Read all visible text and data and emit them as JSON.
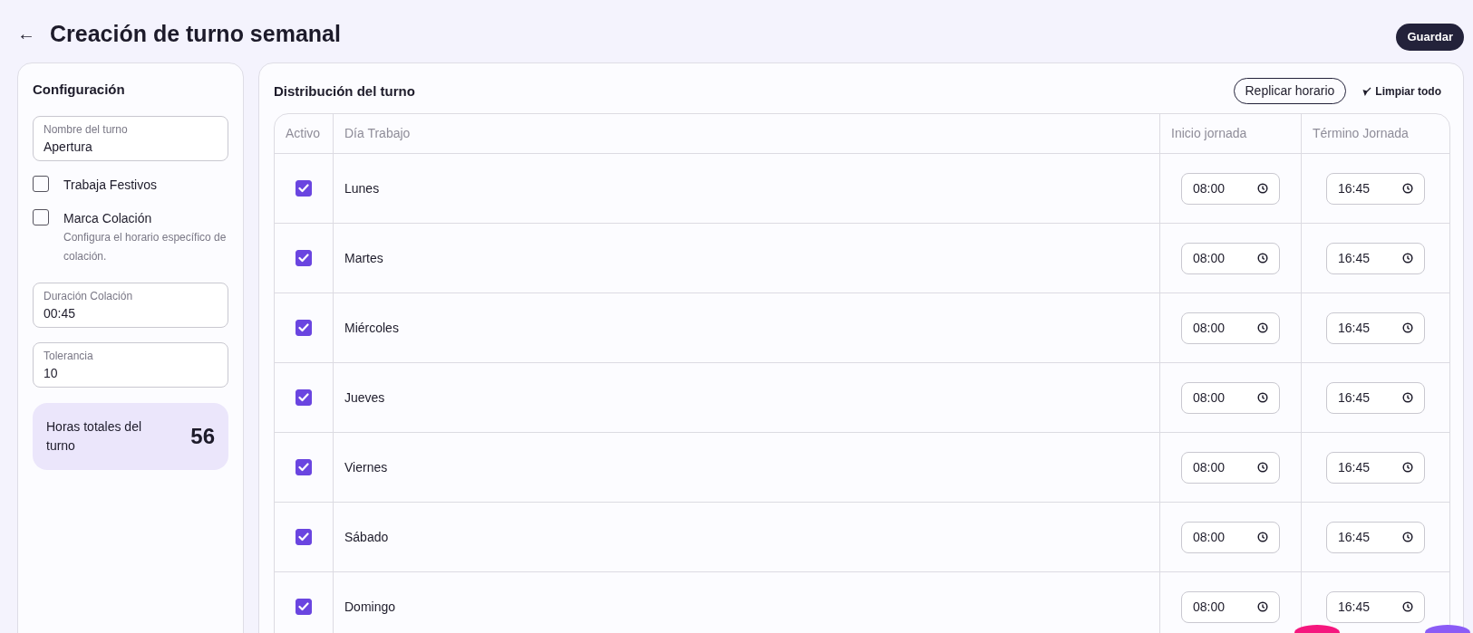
{
  "header": {
    "back_icon": "←",
    "title": "Creación de turno semanal",
    "save_button": "Guardar"
  },
  "config": {
    "title": "Configuración",
    "fields_top": [
      {
        "label": "Nombre del turno",
        "value": "Apertura"
      }
    ],
    "options": [
      {
        "label": "Trabaja Festivos",
        "checked": false
      },
      {
        "label": "Marca Colación",
        "checked": false,
        "help": "Configura el horario específico de colación."
      }
    ],
    "fields_bottom": [
      {
        "label": "Duración Colación",
        "value": "00:45"
      },
      {
        "label": "Tolerancia",
        "value": "10"
      }
    ],
    "total": {
      "label": "Horas totales del turno",
      "value": "56"
    }
  },
  "distribution": {
    "title": "Distribución del turno",
    "replicate_button": "Replicar horario",
    "clear_button": "Limpiar todo",
    "columns": [
      "Activo",
      "Día Trabajo",
      "Inicio jornada",
      "Término Jornada"
    ],
    "rows": [
      {
        "active": true,
        "day": "Lunes",
        "start": "08:00",
        "end": "16:45"
      },
      {
        "active": true,
        "day": "Martes",
        "start": "08:00",
        "end": "16:45"
      },
      {
        "active": true,
        "day": "Miércoles",
        "start": "08:00",
        "end": "16:45"
      },
      {
        "active": true,
        "day": "Jueves",
        "start": "08:00",
        "end": "16:45"
      },
      {
        "active": true,
        "day": "Viernes",
        "start": "08:00",
        "end": "16:45"
      },
      {
        "active": true,
        "day": "Sábado",
        "start": "08:00",
        "end": "16:45"
      },
      {
        "active": true,
        "day": "Domingo",
        "start": "08:00",
        "end": "16:45"
      }
    ]
  }
}
